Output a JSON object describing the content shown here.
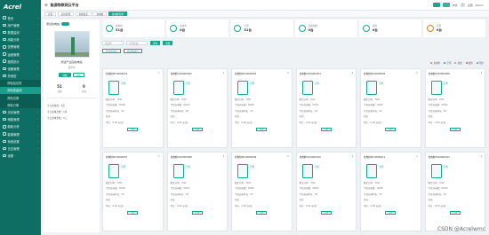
{
  "brand": "Acrel",
  "app_title": "能源物联网云平台",
  "sidebar": [
    {
      "label": "首页"
    },
    {
      "label": "用户管理"
    },
    {
      "label": "数据监测"
    },
    {
      "label": "用能分析"
    },
    {
      "label": "告警管理"
    },
    {
      "label": "运维管理"
    },
    {
      "label": "报表统计"
    },
    {
      "label": "设备管理"
    },
    {
      "label": "充电桩"
    },
    {
      "label": "充电站总览",
      "sub": true
    },
    {
      "label": "充电桩监测",
      "sub": true,
      "active": true
    },
    {
      "label": "充电记录",
      "sub": true
    },
    {
      "label": "充电订单",
      "sub": true
    },
    {
      "label": "光伏管理"
    },
    {
      "label": "储能管理"
    },
    {
      "label": "能耗分析"
    },
    {
      "label": "能源管理"
    },
    {
      "label": "系统设置"
    },
    {
      "label": "日志管理"
    },
    {
      "label": "设置"
    }
  ],
  "topbar": {
    "user": "admin",
    "lang": "中文",
    "status": "主题"
  },
  "tabs": [
    {
      "label": "首页"
    },
    {
      "label": "实时监测"
    },
    {
      "label": "充电总览"
    },
    {
      "label": "充电桩"
    },
    {
      "label": "充电桩监测",
      "active": true
    }
  ],
  "left": {
    "title": "测试充电站",
    "station": "测试产业园充电站",
    "sub": "运营中",
    "btn1": "地图",
    "btn2": "详情",
    "stats": [
      {
        "v": "51",
        "l": "总数"
      },
      {
        "v": "0",
        "l": "在线"
      }
    ],
    "rows": [
      "今日充电量：0度",
      "今日充电次数：0次",
      "今日充电金额：0元"
    ]
  },
  "summary": [
    {
      "l": "充电桩",
      "v": "51台"
    },
    {
      "l": "充电中",
      "v": "0台"
    },
    {
      "l": "空闲",
      "v": "51台"
    },
    {
      "l": "离线总数",
      "v": "0台"
    },
    {
      "l": "离线",
      "v": "0台"
    },
    {
      "l": "告警",
      "v": "0台"
    }
  ],
  "filter": {
    "placeholder": "请选择",
    "select": "全部状态",
    "search": "查询",
    "reset": "重置"
  },
  "chips": [
    "按状态排序",
    "按名称排序"
  ],
  "legend": [
    {
      "l": "充电中",
      "c": "#e67e22"
    },
    {
      "l": "空闲",
      "c": "#17a78f"
    },
    {
      "l": "离线",
      "c": "#999999"
    },
    {
      "l": "故障",
      "c": "#e74c3c"
    },
    {
      "l": "预约",
      "c": "#3498db"
    }
  ],
  "cards": [
    {
      "t": "充电桩0010000001",
      "st": "空闲"
    },
    {
      "t": "充电桩0010000002",
      "st": "空闲"
    },
    {
      "t": "充电桩0010000003",
      "st": "空闲"
    },
    {
      "t": "充电桩0010000004",
      "st": "空闲"
    },
    {
      "t": "充电桩0010000005",
      "st": "空闲"
    },
    {
      "t": "充电桩0010000006",
      "st": "空闲"
    },
    {
      "t": "充电桩0010000007",
      "st": "空闲"
    },
    {
      "t": "充电桩0010000008",
      "st": "空闲"
    },
    {
      "t": "充电桩0010000009",
      "st": "空闲"
    },
    {
      "t": "充电桩0010000010",
      "st": "空闲"
    },
    {
      "t": "充电桩0010000011",
      "st": "空闲"
    },
    {
      "t": "充电桩0010000012",
      "st": "空闲"
    }
  ],
  "card_lines": [
    "额定功率：7kW",
    "今日充电量：0kWh",
    "今日充电时长：0h",
    "状态",
    "单价：0.00 元/度"
  ],
  "card_btn": "详情",
  "watermark": "CSDN @Acrelwmc"
}
